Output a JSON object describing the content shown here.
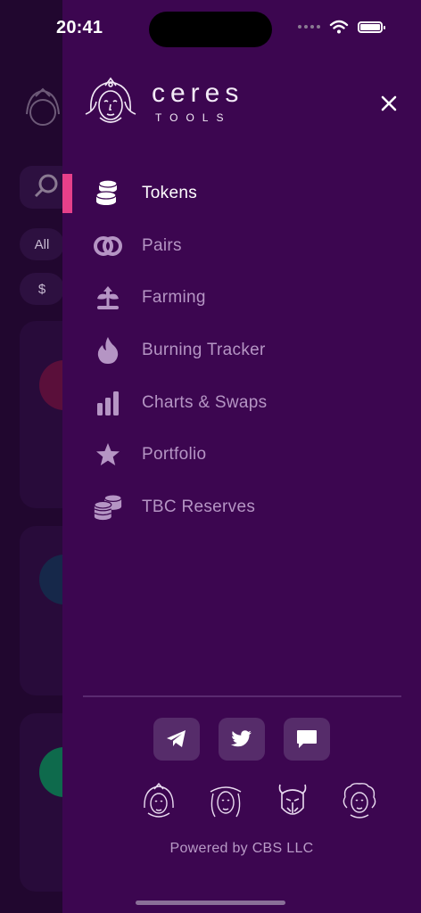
{
  "status_bar": {
    "time": "20:41"
  },
  "background": {
    "chips": [
      "All",
      "$"
    ]
  },
  "brand": {
    "name": "ceres",
    "sub": "TOOLS"
  },
  "menu": {
    "items": [
      {
        "label": "Tokens",
        "icon": "coins-stack-icon",
        "active": true
      },
      {
        "label": "Pairs",
        "icon": "link-rings-icon"
      },
      {
        "label": "Farming",
        "icon": "sprout-icon"
      },
      {
        "label": "Burning Tracker",
        "icon": "flame-icon"
      },
      {
        "label": "Charts & Swaps",
        "icon": "bar-chart-icon"
      },
      {
        "label": "Portfolio",
        "icon": "star-icon"
      },
      {
        "label": "TBC Reserves",
        "icon": "coin-reserves-icon"
      }
    ]
  },
  "footer": {
    "social": [
      "telegram-icon",
      "twitter-icon",
      "chat-icon"
    ],
    "powered_by": "Powered by CBS LLC"
  },
  "colors": {
    "drawer_bg": "#3c0650",
    "accent": "#e6408a",
    "inactive_label": "#b595c4"
  }
}
